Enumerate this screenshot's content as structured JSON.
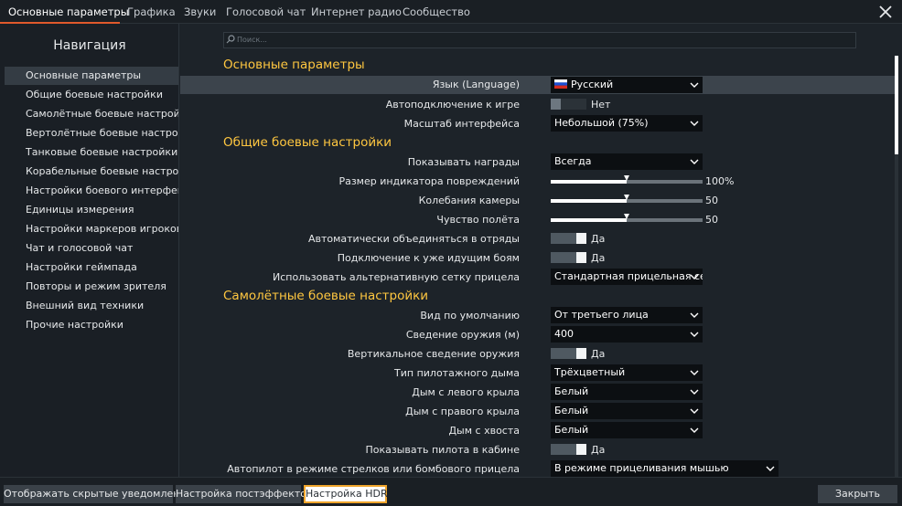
{
  "tabs": [
    {
      "label": "Основные параметры",
      "active": true
    },
    {
      "label": "Графика"
    },
    {
      "label": "Звуки"
    },
    {
      "label": "Голосовой чат"
    },
    {
      "label": "Интернет радио"
    },
    {
      "label": "Сообщество"
    }
  ],
  "window": {
    "close_icon": "close-icon"
  },
  "sidebar": {
    "title": "Навигация",
    "items": [
      "Основные параметры",
      "Общие боевые настройки",
      "Самолётные боевые настройки",
      "Вертолётные боевые настройки",
      "Танковые боевые настройки",
      "Корабельные боевые настройки",
      "Настройки боевого интерфейса",
      "Единицы измерения",
      "Настройки маркеров игроков",
      "Чат и голосовой чат",
      "Настройки геймпада",
      "Повторы и режим зрителя",
      "Внешний вид техники",
      "Прочие настройки"
    ]
  },
  "search": {
    "placeholder": "Поиск..."
  },
  "sections": {
    "basic": "Основные параметры",
    "general": "Общие боевые настройки",
    "aircraft": "Самолётные боевые настройки"
  },
  "settings": {
    "language": {
      "label": "Язык (Language)",
      "value": "Русский"
    },
    "autoconnect": {
      "label": "Автоподключение к игре",
      "value": "Нет",
      "on": false
    },
    "ui_scale": {
      "label": "Масштаб интерфейса",
      "value": "Небольшой (75%)"
    },
    "show_rewards": {
      "label": "Показывать награды",
      "value": "Всегда"
    },
    "damage_indicator": {
      "label": "Размер индикатора повреждений",
      "value": "100%",
      "fraction": 0.5
    },
    "camera_shake": {
      "label": "Колебания камеры",
      "value": "50",
      "fraction": 0.5
    },
    "flight_feel": {
      "label": "Чувство полёта",
      "value": "50",
      "fraction": 0.5
    },
    "auto_squad": {
      "label": "Автоматически объединяться в отряды",
      "value": "Да",
      "on": true
    },
    "join_in_progress": {
      "label": "Подключение к уже идущим боям",
      "value": "Да",
      "on": true
    },
    "alt_reticle": {
      "label": "Использовать альтернативную сетку прицела",
      "value": "Стандартная прицельная се"
    },
    "default_view": {
      "label": "Вид по умолчанию",
      "value": "От третьего лица"
    },
    "convergence": {
      "label": "Сведение оружия (м)",
      "value": "400"
    },
    "vertical_convergence": {
      "label": "Вертикальное сведение оружия",
      "value": "Да",
      "on": true
    },
    "smoke_type": {
      "label": "Тип пилотажного дыма",
      "value": "Трёхцветный"
    },
    "smoke_left": {
      "label": "Дым с левого крыла",
      "value": "Белый"
    },
    "smoke_right": {
      "label": "Дым с правого крыла",
      "value": "Белый"
    },
    "smoke_tail": {
      "label": "Дым с хвоста",
      "value": "Белый"
    },
    "show_pilot": {
      "label": "Показывать пилота в кабине",
      "value": "Да",
      "on": true
    },
    "autopilot": {
      "label": "Автопилот в режиме стрелков или бомбового прицела",
      "value": "В режиме прицеливания мышью"
    }
  },
  "bottom": {
    "hidden_notifications": "Отображать скрытые уведомления",
    "postfx": "Настройка постэффектов",
    "hdr": "Настройка HDR",
    "close": "Закрыть"
  },
  "colors": {
    "accent": "#e0592c",
    "section": "#ffc740",
    "highlight_border": "#f0a52c"
  }
}
